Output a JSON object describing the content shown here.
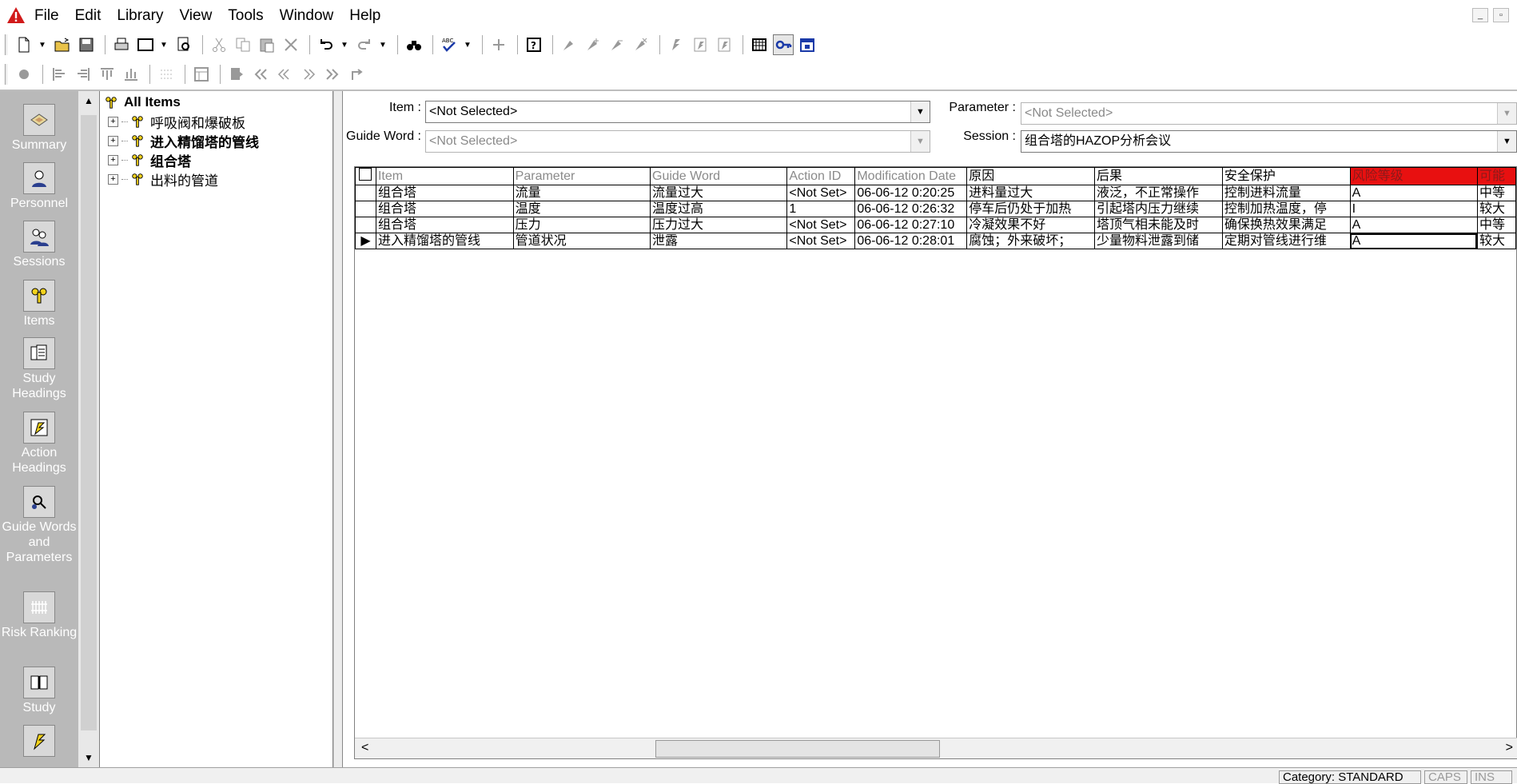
{
  "menubar": {
    "items": [
      "File",
      "Edit",
      "Library",
      "View",
      "Tools",
      "Window",
      "Help"
    ],
    "minimize": "_",
    "restore": "▫"
  },
  "nav": {
    "items": [
      {
        "label": "Summary",
        "icon": "summary-icon"
      },
      {
        "label": "Personnel",
        "icon": "personnel-icon"
      },
      {
        "label": "Sessions",
        "icon": "sessions-icon"
      },
      {
        "label": "Items",
        "icon": "items-icon"
      },
      {
        "label": "Study Headings",
        "icon": "study-headings-icon"
      },
      {
        "label": "Action Headings",
        "icon": "action-headings-icon"
      },
      {
        "label": "Guide Words and Parameters",
        "icon": "guide-words-icon"
      },
      {
        "label": "Risk Ranking",
        "icon": "risk-ranking-icon"
      },
      {
        "label": "Study",
        "icon": "study-icon"
      }
    ]
  },
  "tree": {
    "root": "All Items",
    "children": [
      {
        "label": "呼吸阀和爆破板",
        "bold": false
      },
      {
        "label": "进入精馏塔的管线",
        "bold": true
      },
      {
        "label": "组合塔",
        "bold": true
      },
      {
        "label": "出料的管道",
        "bold": false
      }
    ]
  },
  "filters": {
    "item_label": "Item :",
    "item_value": "<Not Selected>",
    "guide_word_label": "Guide Word :",
    "guide_word_value": "<Not Selected>",
    "parameter_label": "Parameter :",
    "parameter_value": "<Not Selected>",
    "session_label": "Session :",
    "session_value": "组合塔的HAZOP分析会议"
  },
  "grid": {
    "columns": [
      "Item",
      "Parameter",
      "Guide Word",
      "Action ID",
      "Modification Date",
      "原因",
      "后果",
      "安全保护",
      "风险等级",
      "可能"
    ],
    "rows": [
      [
        "组合塔",
        "流量",
        "流量过大",
        "<Not Set>",
        "06-06-12 0:20:25",
        "进料量过大",
        "液泛，不正常操作",
        "控制进料流量",
        "A",
        "中等"
      ],
      [
        "组合塔",
        "温度",
        "温度过高",
        "1",
        "06-06-12 0:26:32",
        "停车后仍处于加热",
        "引起塔内压力继续",
        "控制加热温度，停",
        "I",
        "较大"
      ],
      [
        "组合塔",
        "压力",
        "压力过大",
        "<Not Set>",
        "06-06-12 0:27:10",
        "冷凝效果不好",
        "塔顶气相未能及时",
        "确保换热效果满足",
        "A",
        "中等"
      ],
      [
        "进入精馏塔的管线",
        "管道状况",
        "泄露",
        "<Not Set>",
        "06-06-12 0:28:01",
        "腐蚀；外来破坏；",
        "少量物料泄露到储",
        "定期对管线进行维",
        "A",
        "较大"
      ]
    ],
    "current_row_marker": "▶",
    "scroll_left": "<",
    "scroll_right": ">"
  },
  "status": {
    "category": "Category: STANDARD",
    "caps": "CAPS",
    "ins": "INS"
  },
  "colors": {
    "risk_header": "#e81010",
    "nav_background": "#b9b9b9",
    "app_icon": "#d11a1a"
  }
}
